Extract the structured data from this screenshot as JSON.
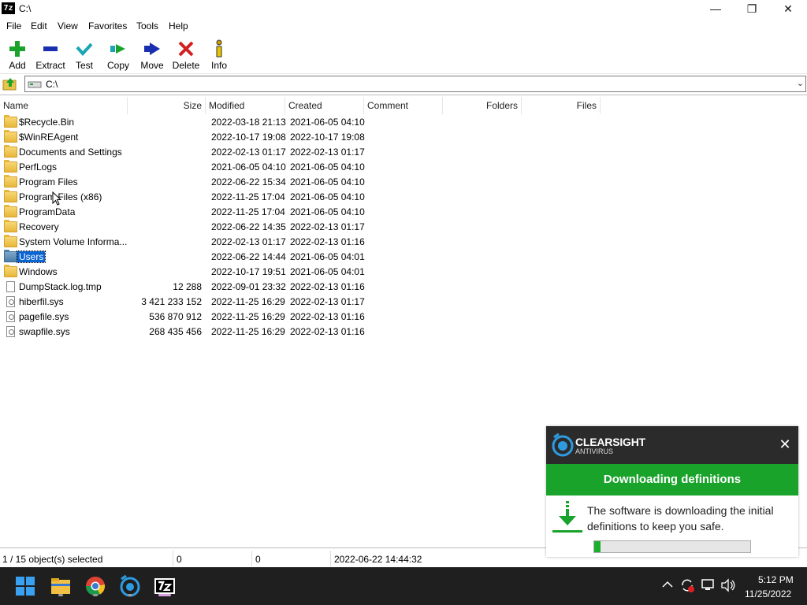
{
  "window": {
    "icon_text": "7z",
    "title": "C:\\",
    "controls": {
      "minimize": "—",
      "maximize": "❐",
      "close": "✕"
    }
  },
  "menu": [
    "File",
    "Edit",
    "View",
    "Favorites",
    "Tools",
    "Help"
  ],
  "toolbar": [
    {
      "label": "Add",
      "icon": "plus-icon",
      "color": "#1aa32b"
    },
    {
      "label": "Extract",
      "icon": "minus-icon",
      "color": "#1a2fb0"
    },
    {
      "label": "Test",
      "icon": "checkmark-icon",
      "color": "#1aa6b4"
    },
    {
      "label": "Copy",
      "icon": "copy-arrow-icon",
      "color": "#1aa32b"
    },
    {
      "label": "Move",
      "icon": "move-arrow-icon",
      "color": "#1a2fb0"
    },
    {
      "label": "Delete",
      "icon": "delete-x-icon",
      "color": "#d21f1f"
    },
    {
      "label": "Info",
      "icon": "info-icon",
      "color": "#c9a000"
    }
  ],
  "address": {
    "path": "C:\\"
  },
  "columns": [
    "Name",
    "Size",
    "Modified",
    "Created",
    "Comment",
    "Folders",
    "Files"
  ],
  "files": [
    {
      "name": "$Recycle.Bin",
      "size": "",
      "modified": "2022-03-18 21:13",
      "created": "2021-06-05 04:10",
      "type": "folder"
    },
    {
      "name": "$WinREAgent",
      "size": "",
      "modified": "2022-10-17 19:08",
      "created": "2022-10-17 19:08",
      "type": "folder"
    },
    {
      "name": "Documents and Settings",
      "size": "",
      "modified": "2022-02-13 01:17",
      "created": "2022-02-13 01:17",
      "type": "folder"
    },
    {
      "name": "PerfLogs",
      "size": "",
      "modified": "2021-06-05 04:10",
      "created": "2021-06-05 04:10",
      "type": "folder"
    },
    {
      "name": "Program Files",
      "size": "",
      "modified": "2022-06-22 15:34",
      "created": "2021-06-05 04:10",
      "type": "folder"
    },
    {
      "name": "Program Files (x86)",
      "size": "",
      "modified": "2022-11-25 17:04",
      "created": "2021-06-05 04:10",
      "type": "folder"
    },
    {
      "name": "ProgramData",
      "size": "",
      "modified": "2022-11-25 17:04",
      "created": "2021-06-05 04:10",
      "type": "folder"
    },
    {
      "name": "Recovery",
      "size": "",
      "modified": "2022-06-22 14:35",
      "created": "2022-02-13 01:17",
      "type": "folder"
    },
    {
      "name": "System Volume Informa...",
      "size": "",
      "modified": "2022-02-13 01:17",
      "created": "2022-02-13 01:16",
      "type": "folder"
    },
    {
      "name": "Users",
      "size": "",
      "modified": "2022-06-22 14:44",
      "created": "2021-06-05 04:01",
      "type": "folder",
      "selected": true
    },
    {
      "name": "Windows",
      "size": "",
      "modified": "2022-10-17 19:51",
      "created": "2021-06-05 04:01",
      "type": "folder"
    },
    {
      "name": "DumpStack.log.tmp",
      "size": "12 288",
      "modified": "2022-09-01 23:32",
      "created": "2022-02-13 01:16",
      "type": "file"
    },
    {
      "name": "hiberfil.sys",
      "size": "3 421 233 152",
      "modified": "2022-11-25 16:29",
      "created": "2022-02-13 01:17",
      "type": "sys"
    },
    {
      "name": "pagefile.sys",
      "size": "536 870 912",
      "modified": "2022-11-25 16:29",
      "created": "2022-02-13 01:16",
      "type": "sys"
    },
    {
      "name": "swapfile.sys",
      "size": "268 435 456",
      "modified": "2022-11-25 16:29",
      "created": "2022-02-13 01:16",
      "type": "sys"
    }
  ],
  "status": {
    "selection": "1 / 15 object(s) selected",
    "size1": "0",
    "size2": "0",
    "modified": "2022-06-22 14:44:32"
  },
  "notification": {
    "brand": "CLEARSIGHT",
    "subbrand": "ANTIVIRUS",
    "headline": "Downloading definitions",
    "message": "The software is downloading the initial definitions to keep you safe.",
    "progress": 0.04,
    "close": "✕",
    "accent": "#1aa32b"
  },
  "taskbar": {
    "apps": [
      "windows-start-icon",
      "file-explorer-icon",
      "chrome-icon",
      "clearsight-icon",
      "7zip-icon"
    ],
    "time": "5:12 PM",
    "date": "11/25/2022"
  }
}
